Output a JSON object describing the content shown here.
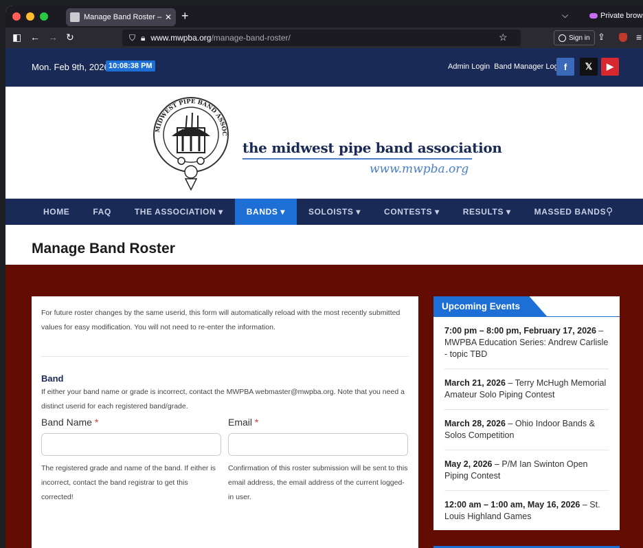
{
  "browser": {
    "tab_title": "Manage Band Roster – The Midw",
    "private_label": "Private browsin",
    "url_host": "www.mwpba.org",
    "url_path": "/manage-band-roster/",
    "signin_label": "Sign in"
  },
  "topbar": {
    "date": "Mon. Feb 9th, 2026",
    "time": "10:08:38 PM",
    "admin_login": "Admin Login",
    "band_manager_login": "Band Manager Login"
  },
  "header": {
    "site_name": "the midwest pipe band association",
    "site_url": "www.mwpba.org",
    "logo_text": "MIDWEST PIPE BAND ASSOCIATION"
  },
  "nav": {
    "items": [
      "HOME",
      "FAQ",
      "THE ASSOCIATION ▾",
      "BANDS ▾",
      "SOLOISTS ▾",
      "CONTESTS ▾",
      "RESULTS ▾",
      "MASSED BANDS"
    ],
    "active_index": 3
  },
  "page": {
    "title": "Manage Band Roster"
  },
  "form": {
    "intro": "For future roster changes by the same userid, this form will automatically reload with the most recently submitted values for easy modification. You will not need to re-enter the information.",
    "section_title": "Band",
    "section_note": "If either your band name or grade is incorrect, contact the MWPBA webmaster@mwpba.org. Note that you need a distinct userid for each registered band/grade.",
    "band_name_label": "Band Name",
    "band_name_value": "",
    "band_name_help": "The registered grade and name of the band. If either is incorrect, contact the band registrar to get this corrected!",
    "email_label": "Email",
    "email_value": "",
    "email_help": "Confirmation of this roster submission will be sent to this email address, the email address of the current logged-in user.",
    "required_mark": "*"
  },
  "events": {
    "heading": "Upcoming Events",
    "items": [
      {
        "when": "7:00 pm – 8:00 pm, February 17, 2026",
        "title": "MWPBA Education Series: Andrew Carlisle - topic TBD"
      },
      {
        "when": "March 21, 2026",
        "title": "Terry McHugh Memorial Amateur Solo Piping Contest"
      },
      {
        "when": "March 28, 2026",
        "title": "Ohio Indoor Bands & Solos Competition"
      },
      {
        "when": "May 2, 2026",
        "title": "P/M Ian Swinton Open Piping Contest"
      },
      {
        "when": "12:00 am – 1:00 am, May 16, 2026",
        "title": "St. Louis Highland Games"
      }
    ]
  },
  "colors": {
    "navy": "#1a2a56",
    "accent_blue": "#1d6fd6",
    "content_bg": "#620c02"
  }
}
